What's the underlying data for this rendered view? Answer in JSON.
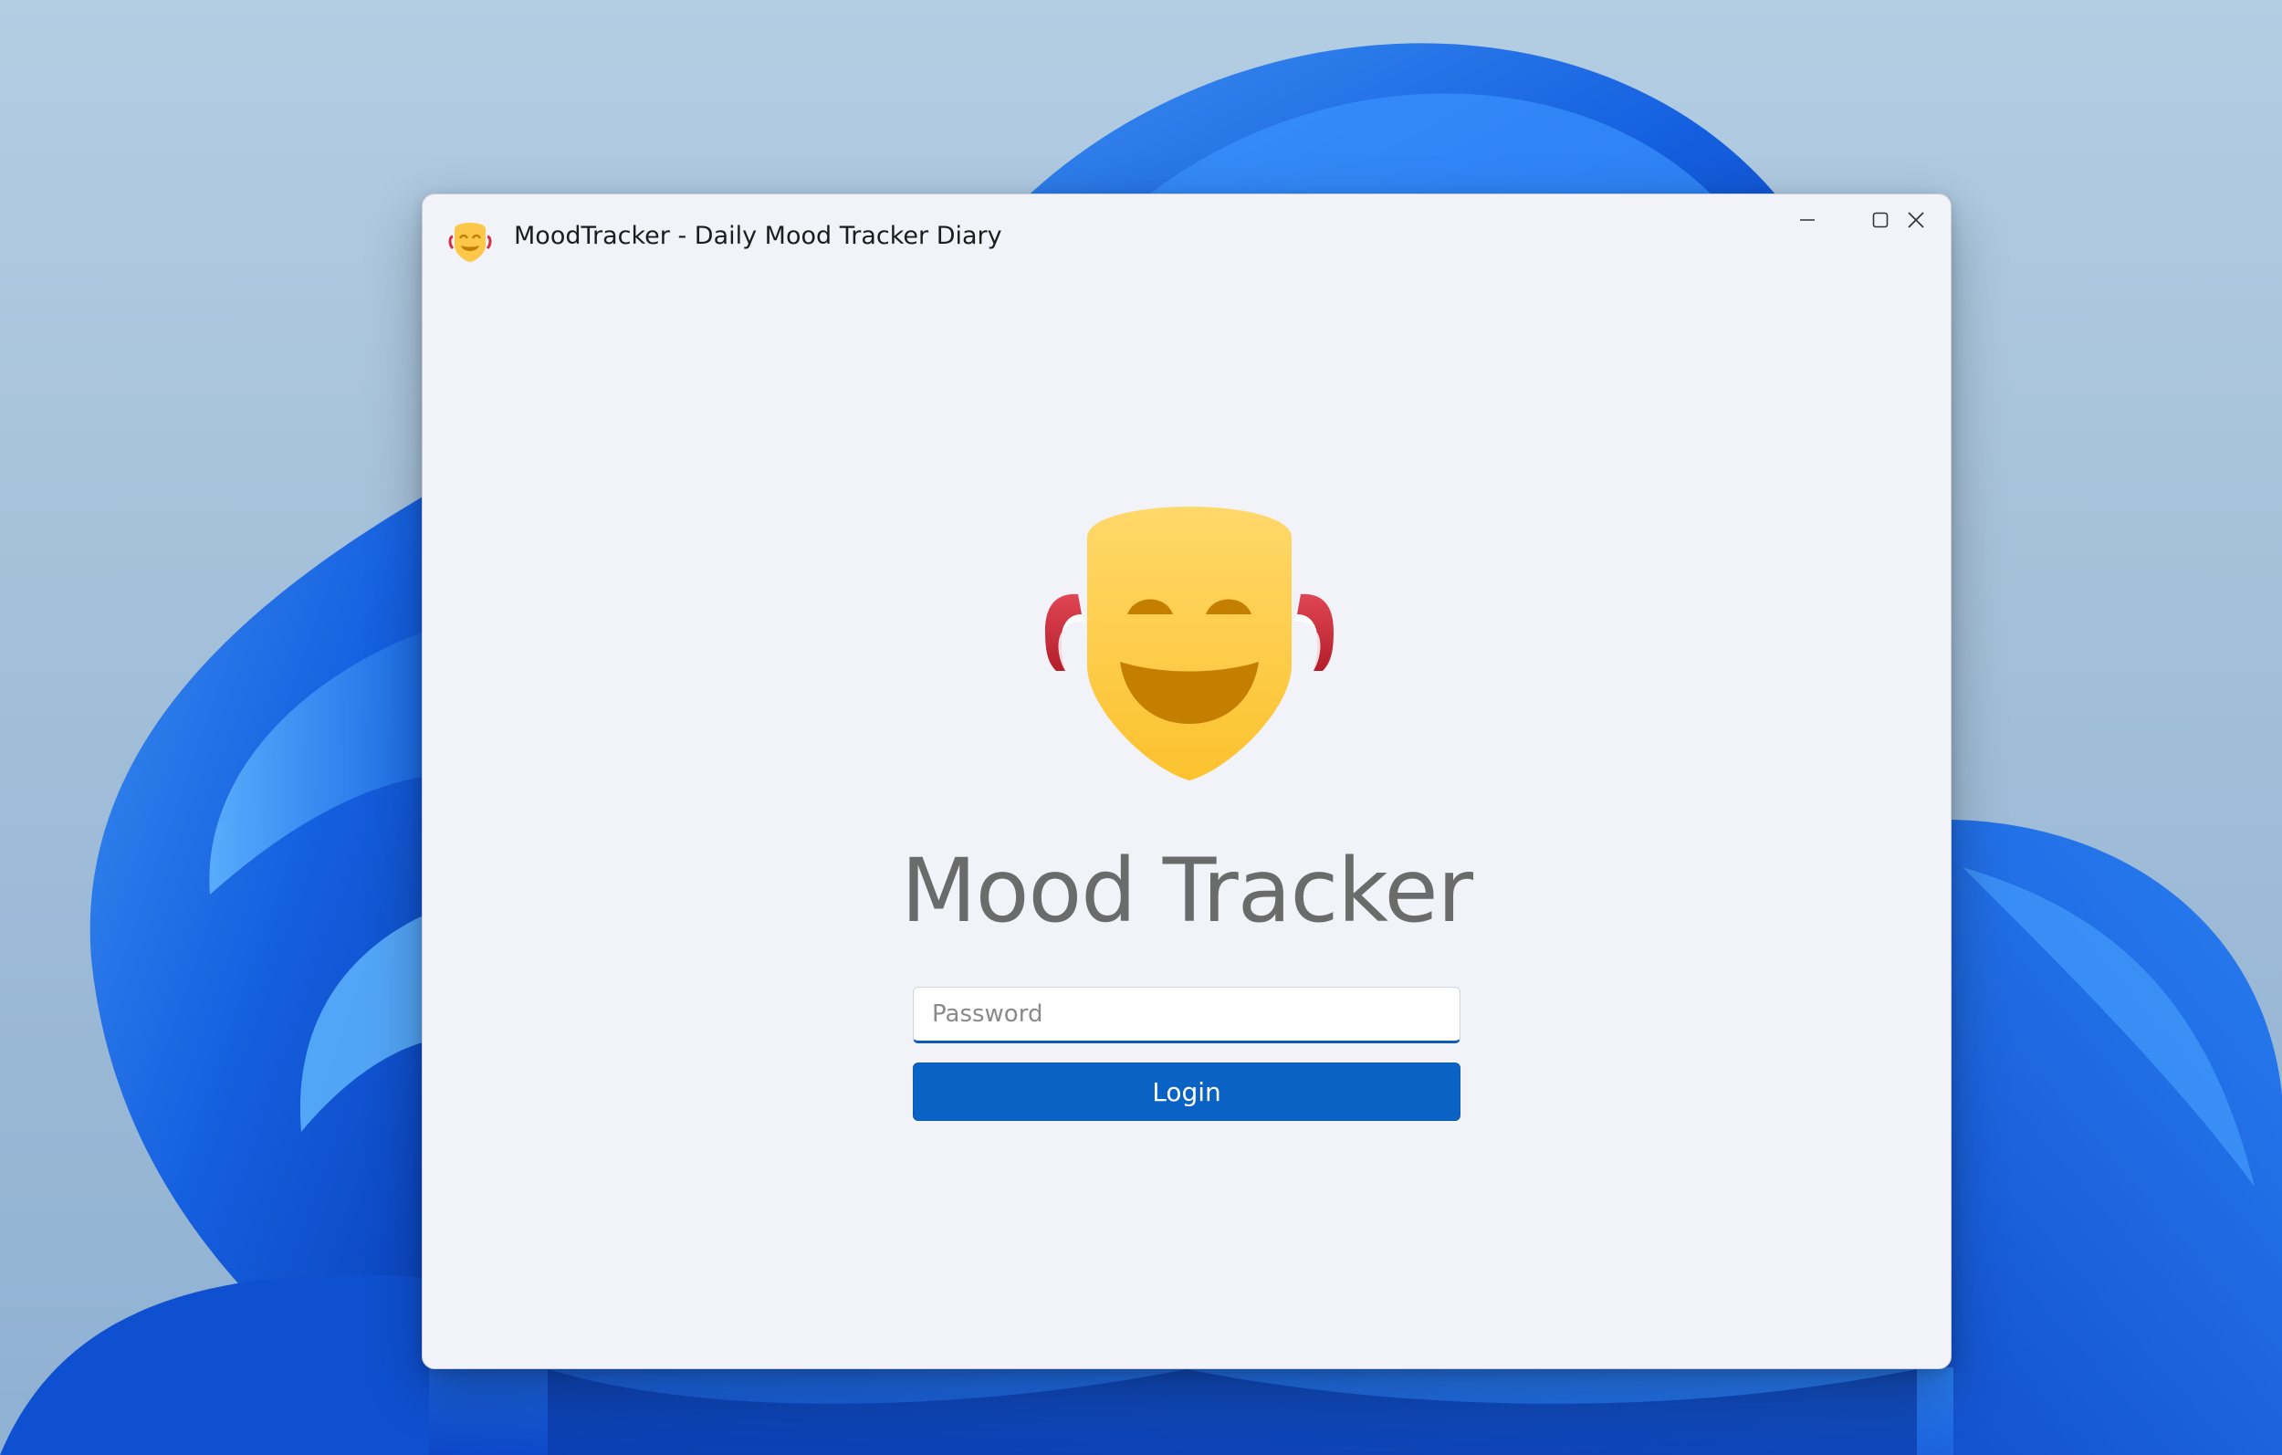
{
  "window": {
    "title": "MoodTracker - Daily Mood Tracker Diary",
    "app_icon": "smiling-mask-icon",
    "controls": {
      "minimize": "minimize-icon",
      "maximize": "maximize-icon",
      "close": "close-icon"
    }
  },
  "login": {
    "logo_icon": "smiling-mask-icon",
    "heading": "Mood Tracker",
    "password_placeholder": "Password",
    "password_value": "",
    "login_label": "Login"
  },
  "colors": {
    "accent": "#0a63c4",
    "mask_yellow": "#fdc84a",
    "mask_features": "#c47f00",
    "mask_straps": "#d0323e"
  }
}
